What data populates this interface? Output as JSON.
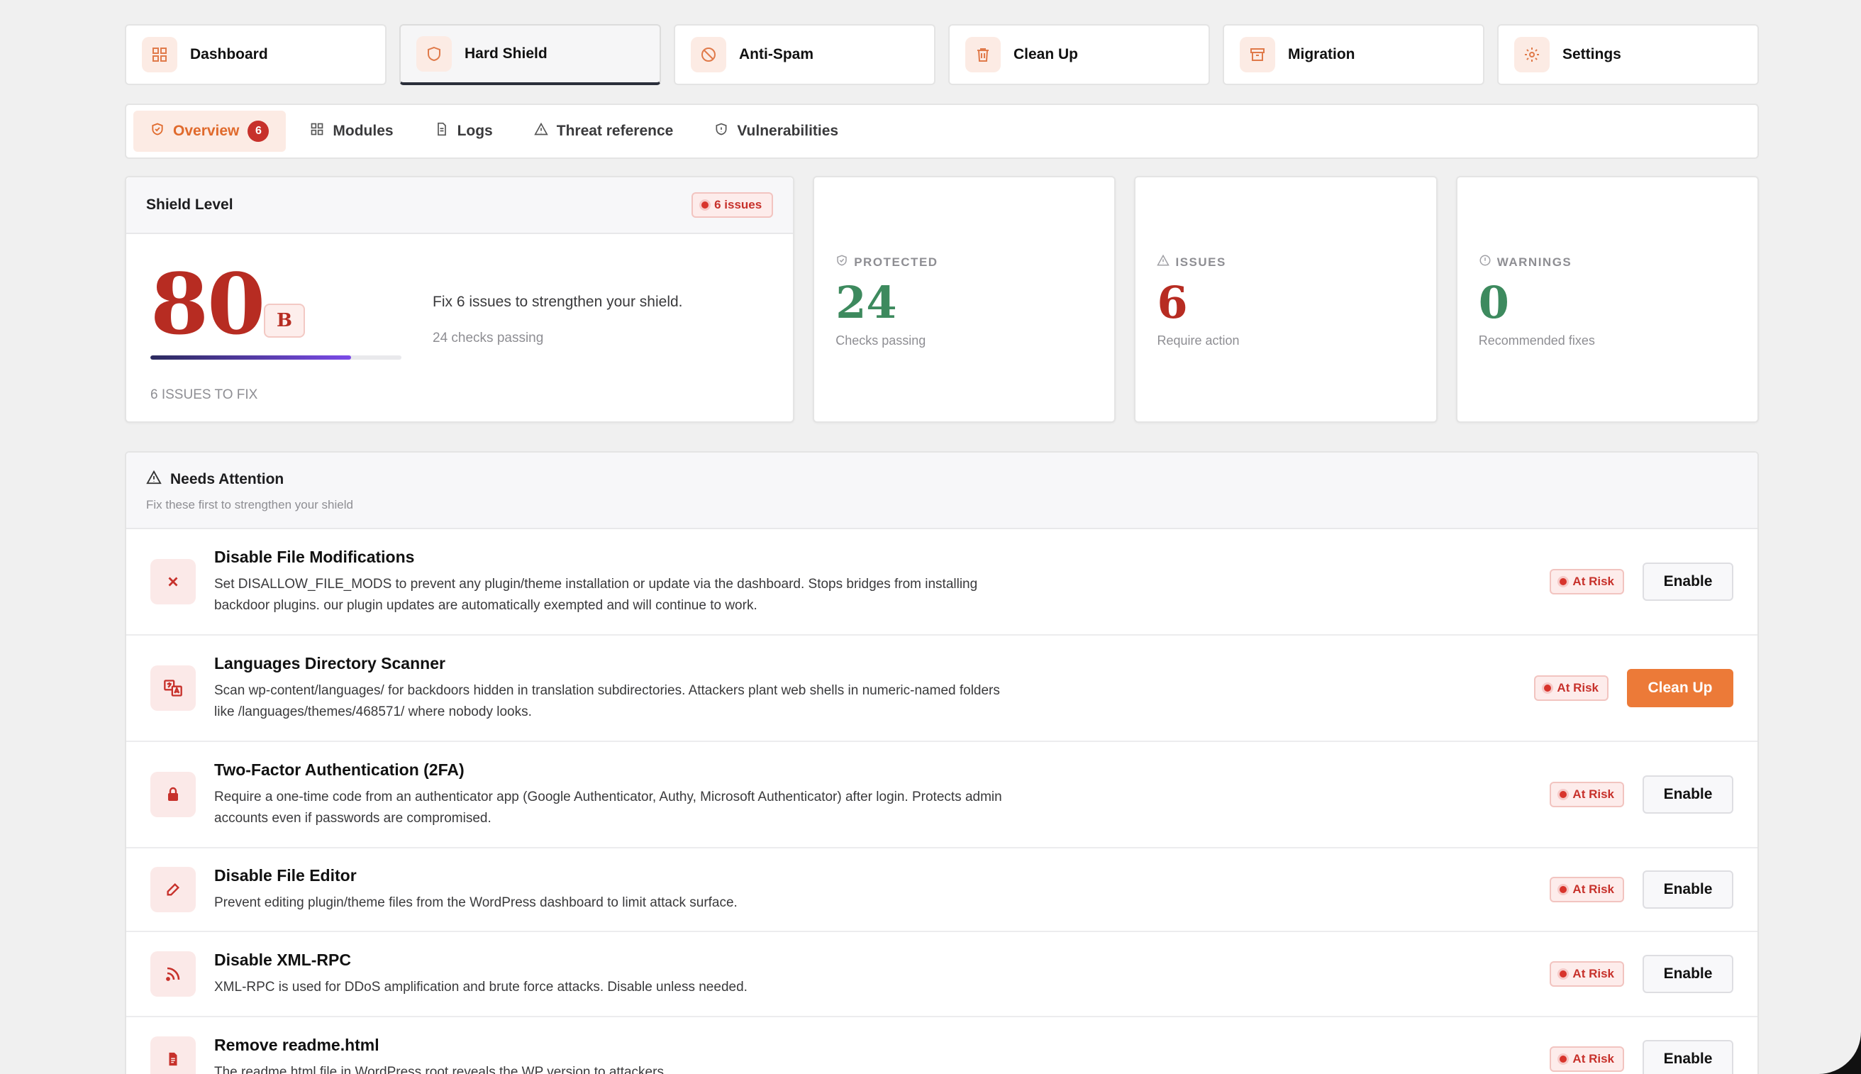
{
  "module_tabs": [
    {
      "label": "Dashboard",
      "icon": "grid-icon"
    },
    {
      "label": "Hard Shield",
      "icon": "shield-icon",
      "active": true
    },
    {
      "label": "Anti-Spam",
      "icon": "ban-icon"
    },
    {
      "label": "Clean Up",
      "icon": "trash-icon"
    },
    {
      "label": "Migration",
      "icon": "archive-icon"
    },
    {
      "label": "Settings",
      "icon": "gear-icon"
    }
  ],
  "sub_tabs": [
    {
      "label": "Overview",
      "badge": "6",
      "active": true
    },
    {
      "label": "Modules"
    },
    {
      "label": "Logs"
    },
    {
      "label": "Threat reference"
    },
    {
      "label": "Vulnerabilities"
    }
  ],
  "shield": {
    "title": "Shield Level",
    "issues_badge": "6 issues",
    "score": "80",
    "grade": "B",
    "progress": 0.8,
    "issues_to_fix": "6 ISSUES TO FIX",
    "message": "Fix 6 issues to strengthen your shield.",
    "checks_passing": "24 checks passing"
  },
  "stats": [
    {
      "label": "PROTECTED",
      "value": "24",
      "sub": "Checks passing",
      "color": "#3d8a5e"
    },
    {
      "label": "ISSUES",
      "value": "6",
      "sub": "Require action",
      "color": "#b72c22"
    },
    {
      "label": "WARNINGS",
      "value": "0",
      "sub": "Recommended fixes",
      "color": "#3d8a5e"
    }
  ],
  "attention": {
    "title": "Needs Attention",
    "subtitle": "Fix these first to strengthen your shield",
    "items": [
      {
        "title": "Disable File Modifications",
        "desc": "Set DISALLOW_FILE_MODS to prevent any plugin/theme installation or update via the dashboard. Stops bridges from installing backdoor plugins. our plugin updates are automatically exempted and will continue to work.",
        "status": "At Risk",
        "action": "Enable"
      },
      {
        "title": "Languages Directory Scanner",
        "desc": "Scan wp-content/languages/ for backdoors hidden in translation subdirectories. Attackers plant web shells in numeric-named folders like /languages/themes/468571/ where nobody looks.",
        "status": "At Risk",
        "action": "Clean Up"
      },
      {
        "title": "Two-Factor Authentication (2FA)",
        "desc": "Require a one-time code from an authenticator app (Google Authenticator, Authy, Microsoft Authenticator) after login. Protects admin accounts even if passwords are compromised.",
        "status": "At Risk",
        "action": "Enable"
      },
      {
        "title": "Disable File Editor",
        "desc": "Prevent editing plugin/theme files from the WordPress dashboard to limit attack surface.",
        "status": "At Risk",
        "action": "Enable"
      },
      {
        "title": "Disable XML-RPC",
        "desc": "XML-RPC is used for DDoS amplification and brute force attacks. Disable unless needed.",
        "status": "At Risk",
        "action": "Enable"
      },
      {
        "title": "Remove readme.html",
        "desc": "The readme.html file in WordPress root reveals the WP version to attackers.",
        "status": "At Risk",
        "action": "Enable"
      }
    ]
  },
  "colors": {
    "accent": "#ec7a38",
    "danger": "#c7312b",
    "success": "#3d8a5e"
  }
}
